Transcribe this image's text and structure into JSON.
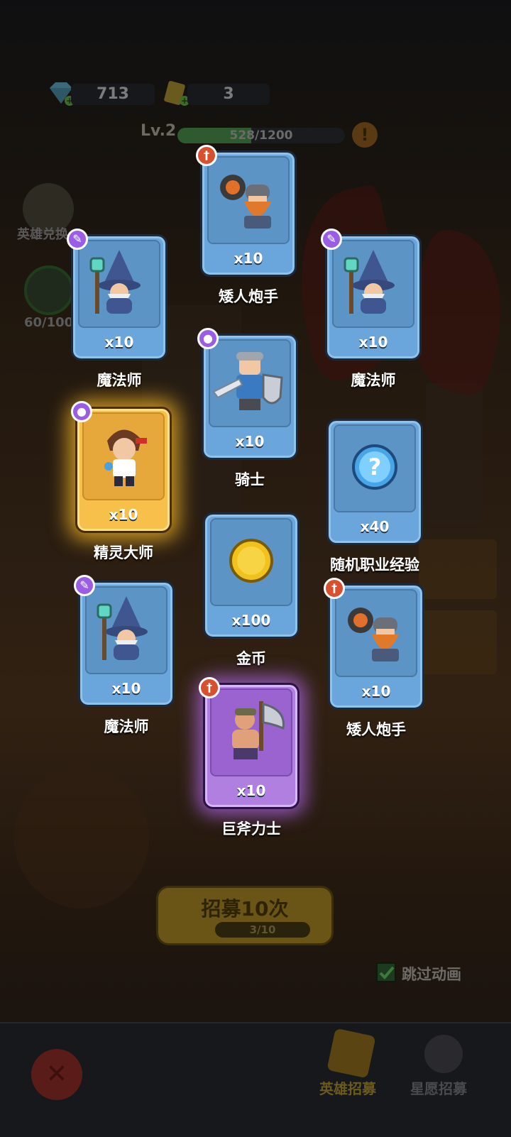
{
  "resources": {
    "gems": "713",
    "tickets": "3"
  },
  "level": {
    "label": "Lv.2",
    "xp_text": "528/1200",
    "xp_fraction": 0.44
  },
  "side": {
    "hero_exchange": "英雄兑换",
    "progress": "60/100"
  },
  "cards": [
    {
      "name": "矮人炮手",
      "qty": "x10",
      "badge": "sword",
      "rarity": "blue",
      "art": "dwarf-cannoneer-icon"
    },
    {
      "name": "魔法师",
      "qty": "x10",
      "badge": "wand",
      "rarity": "blue",
      "art": "wizard-icon"
    },
    {
      "name": "魔法师",
      "qty": "x10",
      "badge": "wand",
      "rarity": "blue",
      "art": "wizard-icon"
    },
    {
      "name": "骑士",
      "qty": "x10",
      "badge": "paw",
      "rarity": "blue",
      "art": "knight-icon"
    },
    {
      "name": "精灵大师",
      "qty": "x10",
      "badge": "paw",
      "rarity": "gold",
      "art": "elf-master-icon"
    },
    {
      "name": "随机职业经验",
      "qty": "x40",
      "badge": "",
      "rarity": "blue",
      "art": "question-orb-icon"
    },
    {
      "name": "金币",
      "qty": "x100",
      "badge": "",
      "rarity": "blue",
      "art": "gold-coin-icon"
    },
    {
      "name": "魔法师",
      "qty": "x10",
      "badge": "wand",
      "rarity": "blue",
      "art": "wizard-icon"
    },
    {
      "name": "矮人炮手",
      "qty": "x10",
      "badge": "sword",
      "rarity": "blue",
      "art": "dwarf-cannoneer-icon"
    },
    {
      "name": "巨斧力士",
      "qty": "x10",
      "badge": "sword",
      "rarity": "purple",
      "art": "axe-warrior-icon"
    }
  ],
  "recruit": {
    "label": "招募10次",
    "progress": "3/10"
  },
  "skip": {
    "label": "跳过动画",
    "checked": true
  },
  "bottom_tabs": {
    "hero_recruit": "英雄招募",
    "wish_recruit": "星愿招募"
  },
  "colors": {
    "card_blue": "#6aa6dc",
    "badge_purple": "#9b5de5",
    "badge_red": "#d9502f",
    "gold_glow": "#f6c04a",
    "purple_glow": "#b07fe0"
  }
}
